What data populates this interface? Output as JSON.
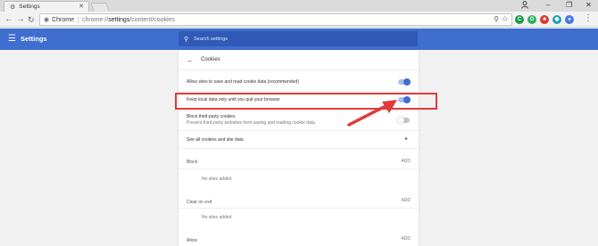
{
  "window": {
    "tab_title": "Settings",
    "tab_icon": "gear-icon",
    "controls": {
      "profile": "person-icon",
      "minimize": "minimize-icon",
      "maximize": "restore-icon",
      "close": "close-icon"
    }
  },
  "toolbar": {
    "chrome_chip": "Chrome",
    "url_scheme": "chrome://",
    "url_host": "settings",
    "url_path": "/content/cookies",
    "extensions": [
      {
        "name": "green-extension-icon",
        "color": "#1a9b4a",
        "glyph": "C"
      },
      {
        "name": "grammar-extension-icon",
        "color": "#2eb15f",
        "glyph": "G"
      },
      {
        "name": "red-extension-icon",
        "color": "#d83b2f",
        "glyph": "■"
      },
      {
        "name": "teal-extension-icon",
        "color": "#19a4b5",
        "glyph": "◉"
      },
      {
        "name": "blue-extension-icon",
        "color": "#4a7ae0",
        "glyph": "●"
      }
    ]
  },
  "header": {
    "title": "Settings",
    "search_placeholder": "Search settings",
    "accent": "#3f6ed0"
  },
  "cookies": {
    "page_title": "Cookies",
    "allow_sites": {
      "label": "Allow sites to save and read cookie data (recommended)",
      "enabled": true
    },
    "keep_local": {
      "label": "Keep local data only until you quit your browser",
      "enabled": true
    },
    "block_third_party": {
      "label": "Block third-party cookies",
      "sub": "Prevent third-party websites from saving and reading cookie data",
      "enabled": false
    },
    "see_all": {
      "label": "See all cookies and site data"
    },
    "block_section": {
      "title": "Block",
      "add": "ADD",
      "empty": "No sites added"
    },
    "clear_section": {
      "title": "Clear on exit",
      "add": "ADD",
      "empty": "No sites added"
    },
    "allow_section": {
      "title": "Allow",
      "add": "ADD"
    }
  },
  "annotation": {
    "color": "#e03a3a"
  }
}
